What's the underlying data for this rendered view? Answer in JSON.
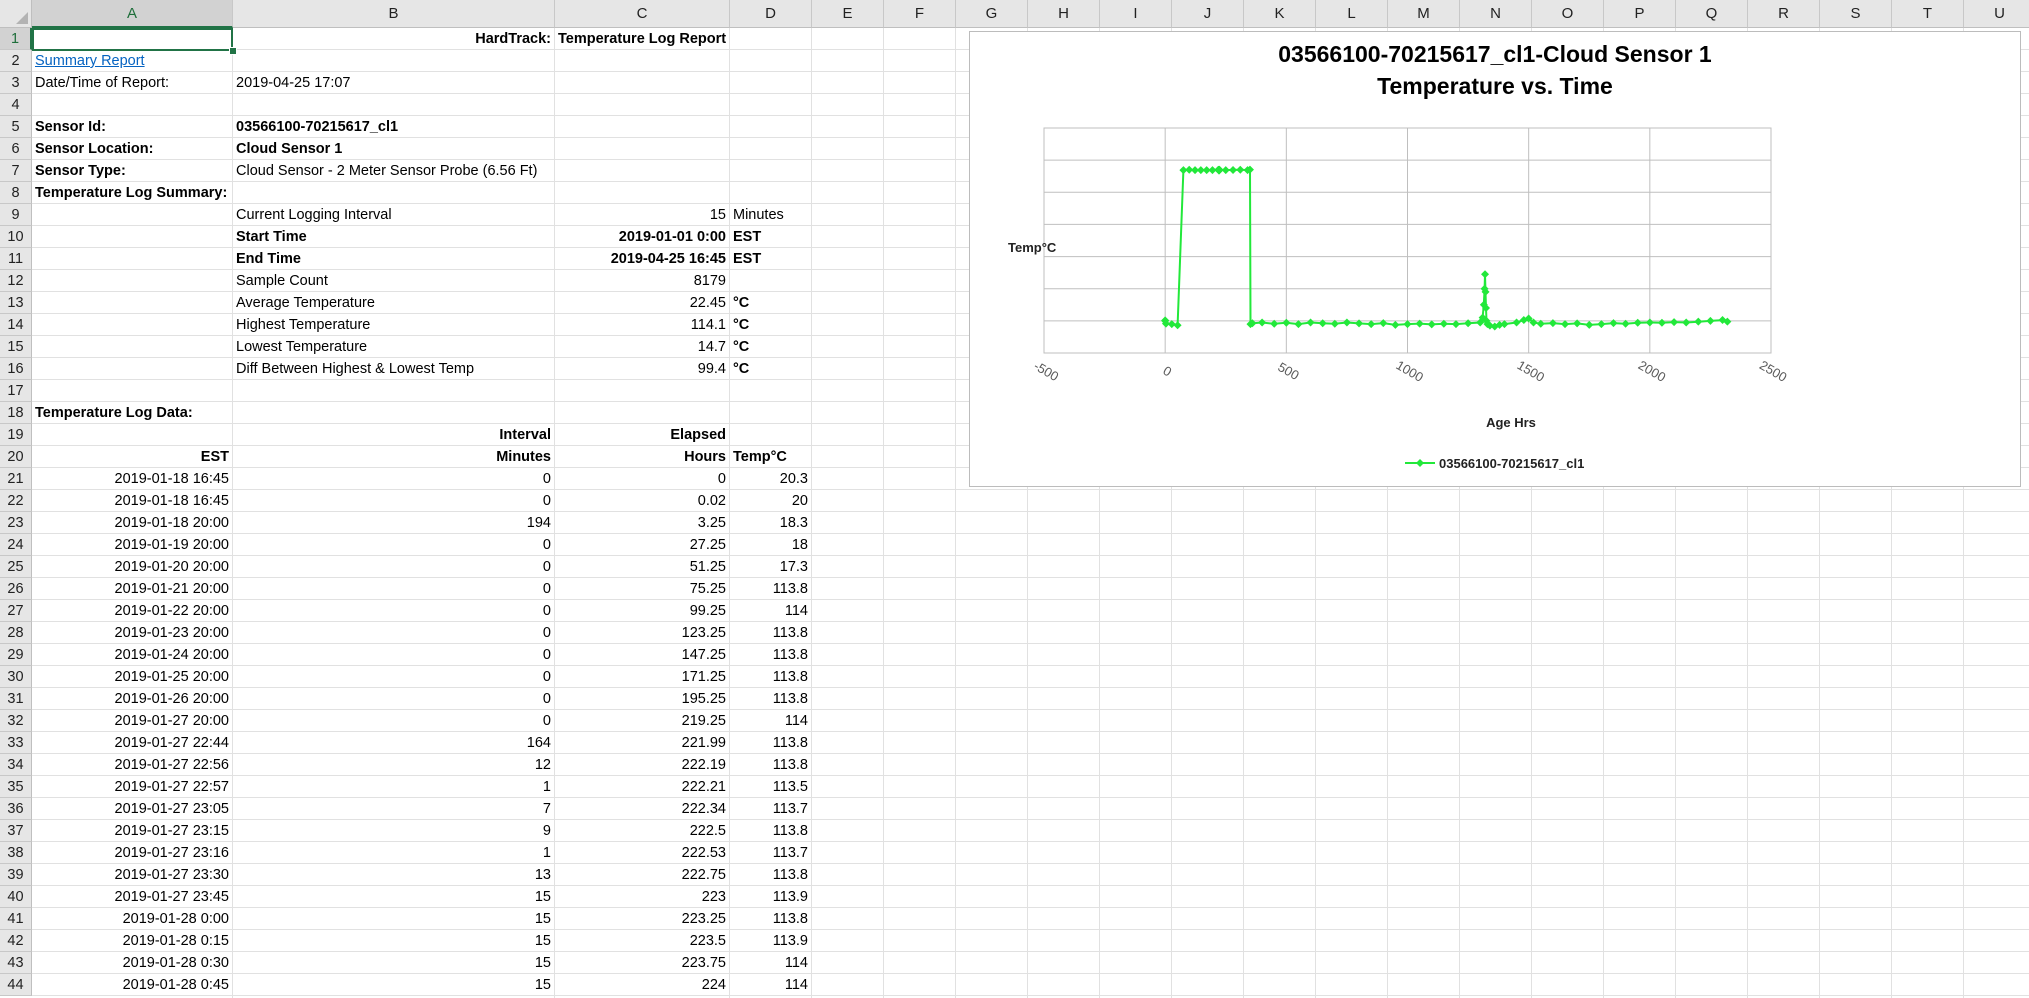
{
  "columns": [
    "A",
    "B",
    "C",
    "D",
    "E",
    "F",
    "G",
    "H",
    "I",
    "J",
    "K",
    "L",
    "M",
    "N",
    "O",
    "P",
    "Q",
    "R",
    "S",
    "T",
    "U"
  ],
  "selected_cell": "A1",
  "report": {
    "title_label": "HardTrack:",
    "title": "Temperature Log Report",
    "summary_link": "Summary Report",
    "datetime_label": "Date/Time of Report:",
    "datetime_value": "2019-04-25 17:07",
    "sensor_id_label": "Sensor Id:",
    "sensor_id": "03566100-70215617_cl1",
    "sensor_location_label": "Sensor Location:",
    "sensor_location": "Cloud Sensor 1",
    "sensor_type_label": "Sensor Type:",
    "sensor_type": "Cloud Sensor - 2 Meter Sensor Probe (6.56 Ft)",
    "summary_heading": "Temperature Log Summary:",
    "summary": [
      {
        "label": "Current Logging Interval",
        "value": "15",
        "unit": "Minutes",
        "bold": false
      },
      {
        "label": "Start Time",
        "value": "2019-01-01 0:00",
        "unit": "EST",
        "bold": true
      },
      {
        "label": "End Time",
        "value": "2019-04-25 16:45",
        "unit": "EST",
        "bold": true
      },
      {
        "label": "Sample Count",
        "value": "8179",
        "unit": "",
        "bold": false
      },
      {
        "label": "Average Temperature",
        "value": "22.45",
        "unit": "°C",
        "bold": false
      },
      {
        "label": "Highest Temperature",
        "value": "114.1",
        "unit": "°C",
        "bold": false
      },
      {
        "label": "Lowest Temperature",
        "value": "14.7",
        "unit": "°C",
        "bold": false
      },
      {
        "label": "Diff Between Highest & Lowest Temp",
        "value": "99.4",
        "unit": "°C",
        "bold": false
      }
    ],
    "log_heading": "Temperature Log Data:",
    "headers": {
      "interval_top": "Interval",
      "elapsed_top": "Elapsed",
      "est": "EST",
      "minutes": "Minutes",
      "hours": "Hours",
      "temp": "Temp°C"
    },
    "log_rows": [
      [
        "2019-01-18 16:45",
        "0",
        "0",
        "20.3"
      ],
      [
        "2019-01-18 16:45",
        "0",
        "0.02",
        "20"
      ],
      [
        "2019-01-18 20:00",
        "194",
        "3.25",
        "18.3"
      ],
      [
        "2019-01-19 20:00",
        "0",
        "27.25",
        "18"
      ],
      [
        "2019-01-20 20:00",
        "0",
        "51.25",
        "17.3"
      ],
      [
        "2019-01-21 20:00",
        "0",
        "75.25",
        "113.8"
      ],
      [
        "2019-01-22 20:00",
        "0",
        "99.25",
        "114"
      ],
      [
        "2019-01-23 20:00",
        "0",
        "123.25",
        "113.8"
      ],
      [
        "2019-01-24 20:00",
        "0",
        "147.25",
        "113.8"
      ],
      [
        "2019-01-25 20:00",
        "0",
        "171.25",
        "113.8"
      ],
      [
        "2019-01-26 20:00",
        "0",
        "195.25",
        "113.8"
      ],
      [
        "2019-01-27 20:00",
        "0",
        "219.25",
        "114"
      ],
      [
        "2019-01-27 22:44",
        "164",
        "221.99",
        "113.8"
      ],
      [
        "2019-01-27 22:56",
        "12",
        "222.19",
        "113.8"
      ],
      [
        "2019-01-27 22:57",
        "1",
        "222.21",
        "113.5"
      ],
      [
        "2019-01-27 23:05",
        "7",
        "222.34",
        "113.7"
      ],
      [
        "2019-01-27 23:15",
        "9",
        "222.5",
        "113.8"
      ],
      [
        "2019-01-27 23:16",
        "1",
        "222.53",
        "113.7"
      ],
      [
        "2019-01-27 23:30",
        "13",
        "222.75",
        "113.8"
      ],
      [
        "2019-01-27 23:45",
        "15",
        "223",
        "113.9"
      ],
      [
        "2019-01-28 0:00",
        "15",
        "223.25",
        "113.8"
      ],
      [
        "2019-01-28 0:15",
        "15",
        "223.5",
        "113.9"
      ],
      [
        "2019-01-28 0:30",
        "15",
        "223.75",
        "114"
      ],
      [
        "2019-01-28 0:45",
        "15",
        "224",
        "114"
      ]
    ]
  },
  "chart_data": {
    "type": "line",
    "title": "03566100-70215617_cl1-Cloud Sensor 1",
    "subtitle": "Temperature vs. Time",
    "xlabel": "Age Hrs",
    "ylabel": "Temp°C",
    "xlim": [
      -500,
      2500
    ],
    "ylim": [
      0,
      140
    ],
    "xticks": [
      -500,
      0,
      500,
      1000,
      1500,
      2000,
      2500
    ],
    "yticks": [
      0,
      20,
      40,
      60,
      80,
      100,
      120,
      140
    ],
    "grid": true,
    "legend_position": "bottom",
    "series": [
      {
        "name": "03566100-70215617_cl1",
        "color": "#22e83a",
        "x": [
          0,
          0.02,
          3.25,
          27.25,
          51.25,
          75.25,
          99.25,
          123.25,
          147.25,
          171.25,
          195.25,
          219.25,
          221.99,
          222.19,
          222.21,
          222.34,
          222.5,
          222.53,
          222.75,
          223,
          223.25,
          223.5,
          223.75,
          224,
          250,
          280,
          310,
          340,
          350,
          352,
          360,
          400,
          450,
          500,
          550,
          600,
          650,
          700,
          750,
          800,
          850,
          900,
          950,
          1000,
          1050,
          1100,
          1150,
          1200,
          1250,
          1300,
          1310,
          1315,
          1318,
          1320,
          1322,
          1324,
          1326,
          1330,
          1340,
          1360,
          1380,
          1400,
          1450,
          1480,
          1500,
          1520,
          1550,
          1600,
          1650,
          1700,
          1750,
          1800,
          1850,
          1900,
          1950,
          2000,
          2050,
          2100,
          2150,
          2200,
          2250,
          2300,
          2320
        ],
        "y": [
          20.3,
          20,
          18.3,
          18,
          17.3,
          113.8,
          114,
          113.8,
          113.8,
          113.8,
          113.8,
          114,
          113.8,
          113.8,
          113.5,
          113.7,
          113.8,
          113.7,
          113.8,
          113.9,
          113.8,
          113.9,
          114,
          114,
          113.8,
          113.9,
          114,
          113.8,
          114.1,
          18,
          18.5,
          19,
          18.2,
          18.8,
          18,
          19,
          18.5,
          18.2,
          19,
          18.4,
          18,
          18.6,
          17.5,
          18,
          18.3,
          17.8,
          18.2,
          18,
          18.5,
          19,
          22,
          30,
          40,
          49,
          38,
          28,
          20,
          18,
          17,
          16.5,
          17.5,
          18,
          19,
          20.5,
          21.5,
          19,
          18.2,
          18.6,
          18,
          18.4,
          17.5,
          18,
          18.6,
          18.2,
          18.8,
          19,
          18.8,
          19.2,
          19,
          19.5,
          20,
          20.5,
          19.5
        ]
      }
    ]
  }
}
